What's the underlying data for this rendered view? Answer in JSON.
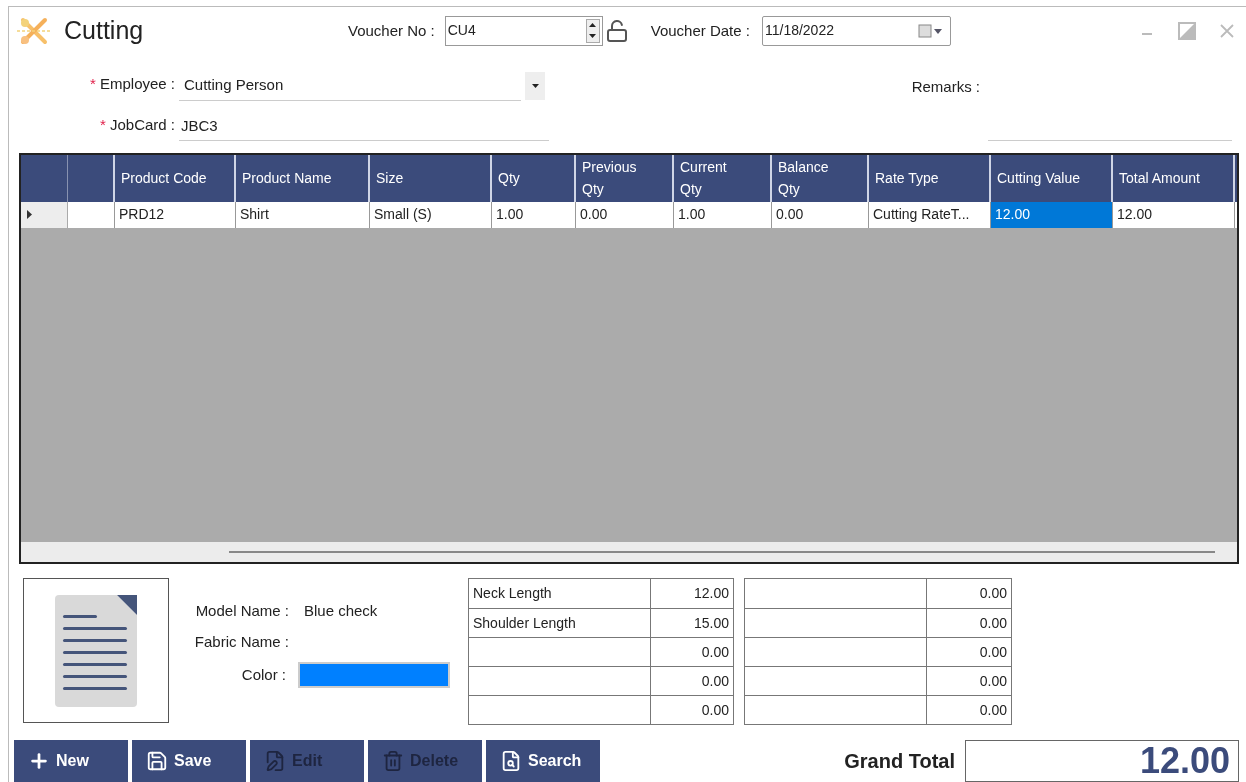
{
  "window": {
    "title": "Cutting"
  },
  "voucher_no": {
    "label": "Voucher No :",
    "value": "CU4",
    "locked": false
  },
  "voucher_date": {
    "label": "Voucher Date :",
    "value": "11/18/2022"
  },
  "employee": {
    "required_mark": "*",
    "label": "Employee :",
    "value": "Cutting Person"
  },
  "jobcard": {
    "required_mark": "*",
    "label": "JobCard :",
    "value": "JBC3"
  },
  "remarks": {
    "label": "Remarks :"
  },
  "table": {
    "columns": [
      "",
      "Product Code",
      "Product Name",
      "Size",
      "Qty",
      "Previous Qty",
      "Current Qty",
      "Balance Qty",
      "Rate Type",
      "Cutting Value",
      "Total Amount"
    ],
    "rows": [
      {
        "selected": true,
        "cells": [
          {
            "text": "",
            "selected": false
          },
          {
            "text": "PRD12",
            "selected": false
          },
          {
            "text": "Shirt",
            "selected": false
          },
          {
            "text": "Small (S)",
            "selected": false
          },
          {
            "text": "1.00",
            "selected": false
          },
          {
            "text": "0.00",
            "selected": false
          },
          {
            "text": "1.00",
            "selected": false
          },
          {
            "text": "0.00",
            "selected": false
          },
          {
            "text": "Cutting RateT...",
            "selected": false
          },
          {
            "text": "12.00",
            "selected": true
          },
          {
            "text": "12.00",
            "selected": false
          }
        ]
      }
    ]
  },
  "details": {
    "model_name": {
      "label": "Model Name :",
      "value": "Blue check"
    },
    "fabric_name": {
      "label": "Fabric Name :"
    },
    "color": {
      "label": "Color :",
      "color": "#0080ff"
    }
  },
  "measurements_left": [
    {
      "name": "Neck Length",
      "value": "12.00"
    },
    {
      "name": "Shoulder Length",
      "value": "15.00"
    },
    {
      "value": "0.00"
    },
    {
      "value": "0.00"
    },
    {
      "value": "0.00"
    }
  ],
  "measurements_right": [
    {
      "value": "0.00"
    },
    {
      "value": "0.00"
    },
    {
      "value": "0.00"
    },
    {
      "value": "0.00"
    },
    {
      "value": "0.00"
    }
  ],
  "buttons": [
    {
      "kind": "new",
      "label": "New",
      "disabled": false
    },
    {
      "kind": "save",
      "label": "Save",
      "disabled": false
    },
    {
      "kind": "edit",
      "label": "Edit",
      "disabled": true
    },
    {
      "kind": "delete",
      "label": "Delete",
      "disabled": true
    },
    {
      "kind": "search",
      "label": "Search",
      "disabled": false
    }
  ],
  "grand_total": {
    "label": "Grand Total",
    "value": "12.00"
  }
}
